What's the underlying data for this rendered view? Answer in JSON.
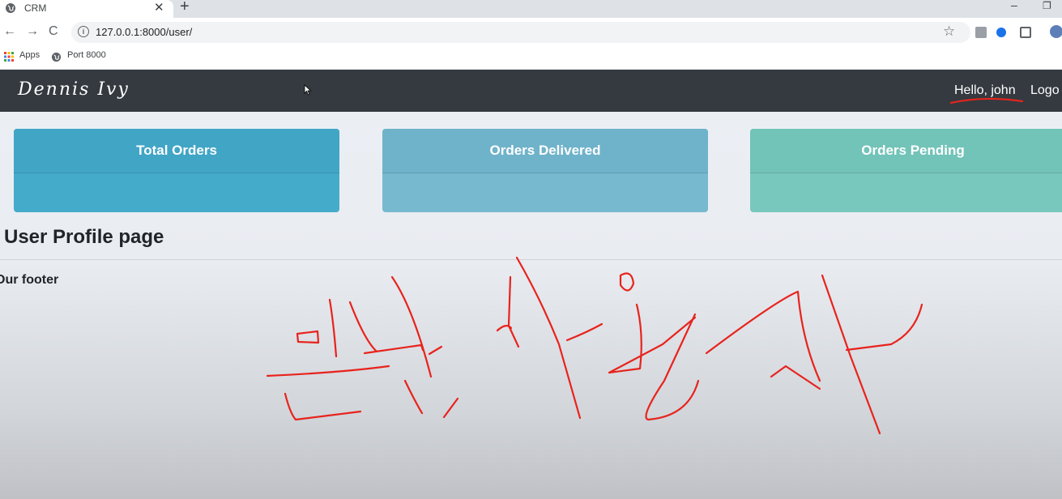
{
  "browser": {
    "tab_title": "CRM",
    "tab_close": "✕",
    "new_tab": "+",
    "minimize": "–",
    "restore": "❐",
    "url": "127.0.0.1:8000/user/",
    "bookmarks": [
      {
        "label": "Apps",
        "icon": "apps-grid-icon"
      },
      {
        "label": "Port 8000",
        "icon": "globe-icon"
      }
    ]
  },
  "navbar": {
    "brand": "Dennis Ivy",
    "greeting": "Hello, john",
    "logout": "Logo"
  },
  "cards": [
    {
      "title": "Total Orders",
      "color": "#41a5c6"
    },
    {
      "title": "Orders Delivered",
      "color": "#6fb3ca"
    },
    {
      "title": "Orders Pending",
      "color": "#72c3b8"
    }
  ],
  "main": {
    "page_title": "User Profile page",
    "footer": "Our footer"
  },
  "annotation": {
    "handwriting": "관리자 사용자",
    "ink_color": "#e8231c"
  }
}
